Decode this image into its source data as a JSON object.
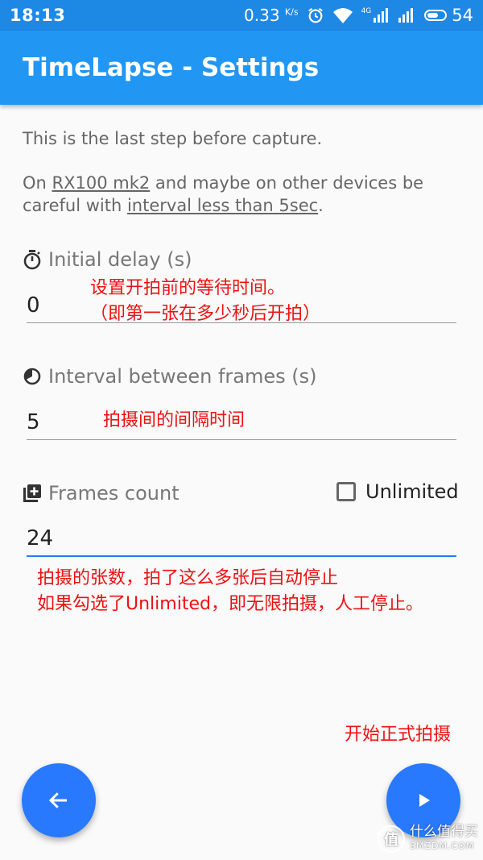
{
  "status_bar": {
    "time": "18:13",
    "speed_value": "0.33",
    "speed_unit": "K/s",
    "network_label": "4G",
    "battery": "54"
  },
  "app_bar": {
    "title": "TimeLapse - Settings"
  },
  "intro": {
    "line1": "This is the last step before capture.",
    "line2_prefix": "On ",
    "line2_link1": "RX100 mk2",
    "line2_middle": " and maybe on other devices be careful with ",
    "line2_link2": "interval less than 5sec",
    "line2_suffix": "."
  },
  "fields": {
    "initial_delay": {
      "label": "Initial delay (s)",
      "value": "0",
      "icon": "timer-icon"
    },
    "interval": {
      "label": "Interval between frames (s)",
      "value": "5",
      "icon": "interval-icon"
    },
    "frames_count": {
      "label": "Frames count",
      "value": "24",
      "icon": "add-box-icon"
    },
    "unlimited": {
      "label": "Unlimited",
      "checked": false
    }
  },
  "annotations": {
    "delay_line1": "设置开拍前的等待时间。",
    "delay_line2": "（即第一张在多少秒后开拍）",
    "interval": "拍摄间的间隔时间",
    "frames_line1": "拍摄的张数，拍了这么多张后自动停止",
    "frames_line2": "如果勾选了Unlimited，即无限拍摄，人工停止。",
    "start": "开始正式拍摄"
  },
  "watermark": {
    "circle": "值",
    "cn": "什么值得买",
    "en": "SMZDM.COM"
  },
  "colors": {
    "status_bar": "#1e88e5",
    "app_bar": "#2196f3",
    "fab": "#2979ff",
    "annotation": "#ee1111"
  }
}
